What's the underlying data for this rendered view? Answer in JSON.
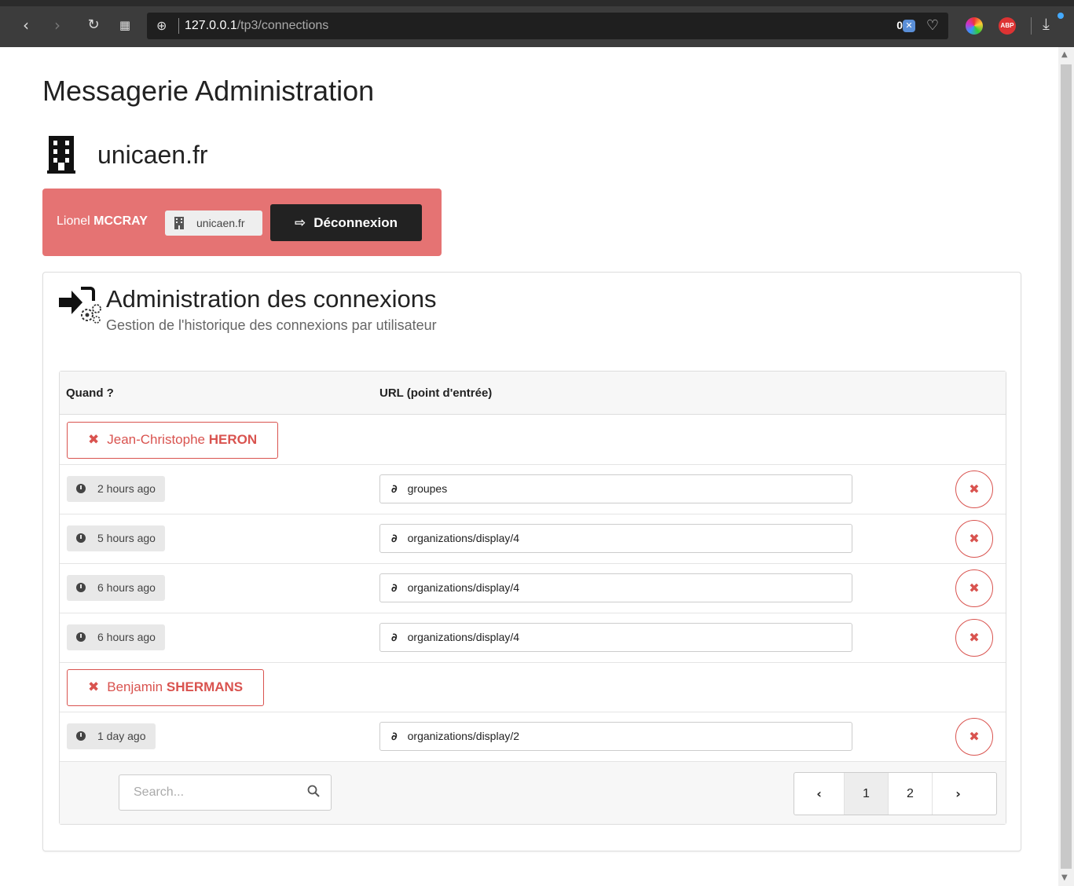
{
  "browser": {
    "url_host": "127.0.0.1",
    "url_path": "/tp3/connections",
    "blocked_count": "0",
    "ext_abp_label": "ABP"
  },
  "app": {
    "title": "Messagerie Administration"
  },
  "organization": {
    "name": "unicaen.fr"
  },
  "user_bar": {
    "first_name": "Lionel",
    "last_name": "MCCRAY",
    "org_tag": "unicaen.fr",
    "logout_label": "Déconnexion"
  },
  "panel": {
    "title": "Administration des connexions",
    "subtitle": "Gestion de l'historique des connexions par utilisateur"
  },
  "table": {
    "headers": {
      "when": "Quand ?",
      "url": "URL (point d'entrée)"
    },
    "groups": [
      {
        "user_first": "Jean-Christophe",
        "user_last": "HERON",
        "connections": [
          {
            "when": "2 hours ago",
            "url": "groupes"
          },
          {
            "when": "5 hours ago",
            "url": "organizations/display/4"
          },
          {
            "when": "6 hours ago",
            "url": "organizations/display/4"
          },
          {
            "when": "6 hours ago",
            "url": "organizations/display/4"
          }
        ]
      },
      {
        "user_first": "Benjamin",
        "user_last": "SHERMANS",
        "connections": [
          {
            "when": "1 day ago",
            "url": "organizations/display/2"
          }
        ]
      }
    ]
  },
  "footer": {
    "search_placeholder": "Search...",
    "pages": [
      "1",
      "2"
    ],
    "active_page": "1"
  },
  "colors": {
    "user_bar_bg": "#e57373",
    "danger": "#d9534f",
    "dark_button": "#222222"
  },
  "icons": {
    "building": "building-icon",
    "sign_out": "sign-out-icon",
    "connections": "sign-in-gears-icon",
    "remove": "times-icon",
    "clock": "clock-icon",
    "link": "link-icon",
    "search": "search-icon",
    "prev": "chevron-left-icon",
    "next": "chevron-right-icon"
  }
}
